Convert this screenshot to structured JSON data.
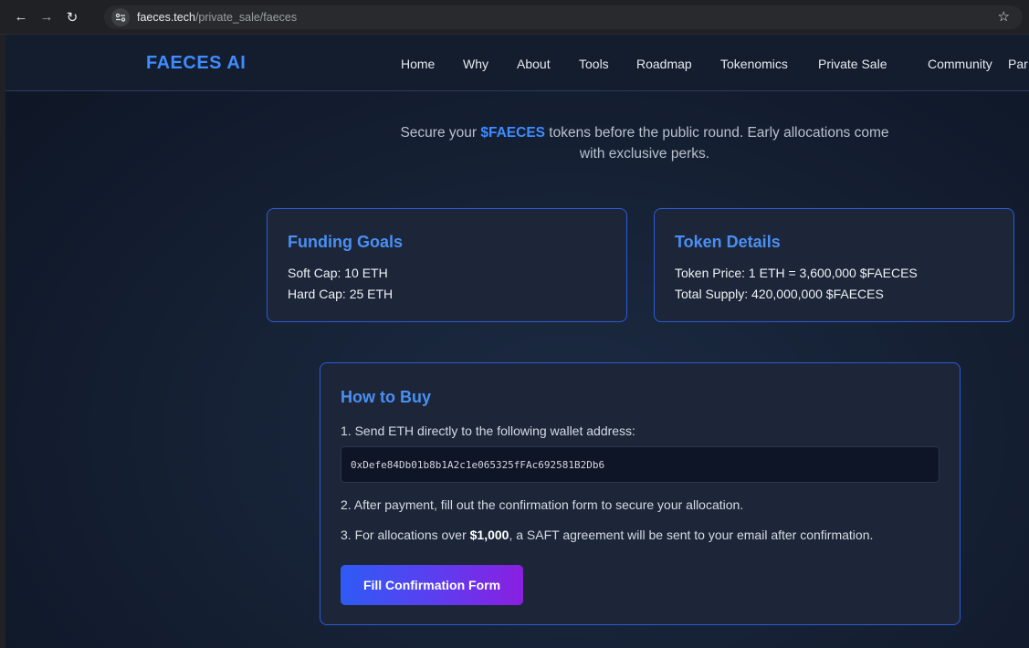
{
  "browser": {
    "url_host": "faeces.tech",
    "url_path": "/private_sale/faeces"
  },
  "site": {
    "logo": "FAECES AI",
    "nav": [
      "Home",
      "Why",
      "About",
      "Tools",
      "Roadmap",
      "Tokenomics",
      "Private Sale",
      "Community",
      "Par"
    ]
  },
  "intro": {
    "prefix": "Secure your ",
    "highlight": "$FAECES",
    "suffix": " tokens before the public round. Early allocations come with exclusive perks."
  },
  "funding": {
    "title": "Funding Goals",
    "soft_cap": "Soft Cap: 10 ETH",
    "hard_cap": "Hard Cap: 25 ETH"
  },
  "token": {
    "title": "Token Details",
    "price": "Token Price: 1 ETH = 3,600,000 $FAECES",
    "supply": "Total Supply: 420,000,000 $FAECES"
  },
  "how_to_buy": {
    "title": "How to Buy",
    "step1": "1. Send ETH directly to the following wallet address:",
    "wallet": "0xDefe84Db01b8b1A2c1e065325fFAc692581B2Db6",
    "step2": "2. After payment, fill out the confirmation form to secure your allocation.",
    "step3_prefix": "3. For allocations over ",
    "step3_bold": "$1,000",
    "step3_suffix": ", a SAFT agreement will be sent to your email after confirmation.",
    "button": "Fill Confirmation Form"
  },
  "colors": {
    "accent": "#3f8cff",
    "card_border": "#2c5bd6",
    "button_start": "#2f5bf5",
    "button_end": "#8a1fe0"
  }
}
